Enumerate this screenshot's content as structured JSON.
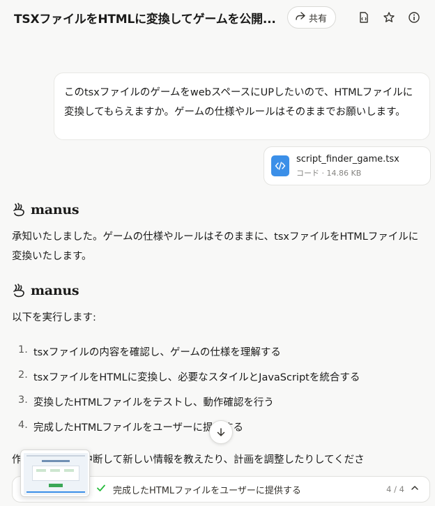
{
  "header": {
    "title": "TSXファイルをHTMLに変換してゲームを公開...",
    "share_label": "共有",
    "icons": [
      "share-arrow-icon",
      "document-icon",
      "star-icon",
      "info-icon"
    ]
  },
  "user_message": {
    "text": "このtsxファイルのゲームをwebスペースにUPしたいので、HTMLファイルに変換してもらえますか。ゲームの仕様やルールはそのままでお願いします。"
  },
  "attachment": {
    "name": "script_finder_game.tsx",
    "meta": "コード · 14.86 KB",
    "icon": "code-file-icon"
  },
  "messages": [
    {
      "agent": "manus",
      "text": "承知いたしました。ゲームの仕様やルールはそのままに、tsxファイルをHTMLファイルに変換いたします。"
    },
    {
      "agent": "manus",
      "intro": "以下を実行します:",
      "steps": [
        {
          "num": "1.",
          "text": "tsxファイルの内容を確認し、ゲームの仕様を理解する"
        },
        {
          "num": "2.",
          "text": "tsxファイルをHTMLに変換し、必要なスタイルとJavaScriptを統合する"
        },
        {
          "num": "3.",
          "text": "変換したHTMLファイルをテストし、動作確認を行う"
        },
        {
          "num": "4.",
          "text": "完成したHTMLファイルをユーザーに提供する"
        }
      ],
      "trailing": "作業中でも私を中断して新しい情報を教えたり、計画を調整したりしてくださ"
    }
  ],
  "task_bar": {
    "status_text": "完成したHTMLファイルをユーザーに提供する",
    "progress": "4 / 4",
    "icons": [
      "check-icon",
      "chevron-up-icon"
    ]
  }
}
